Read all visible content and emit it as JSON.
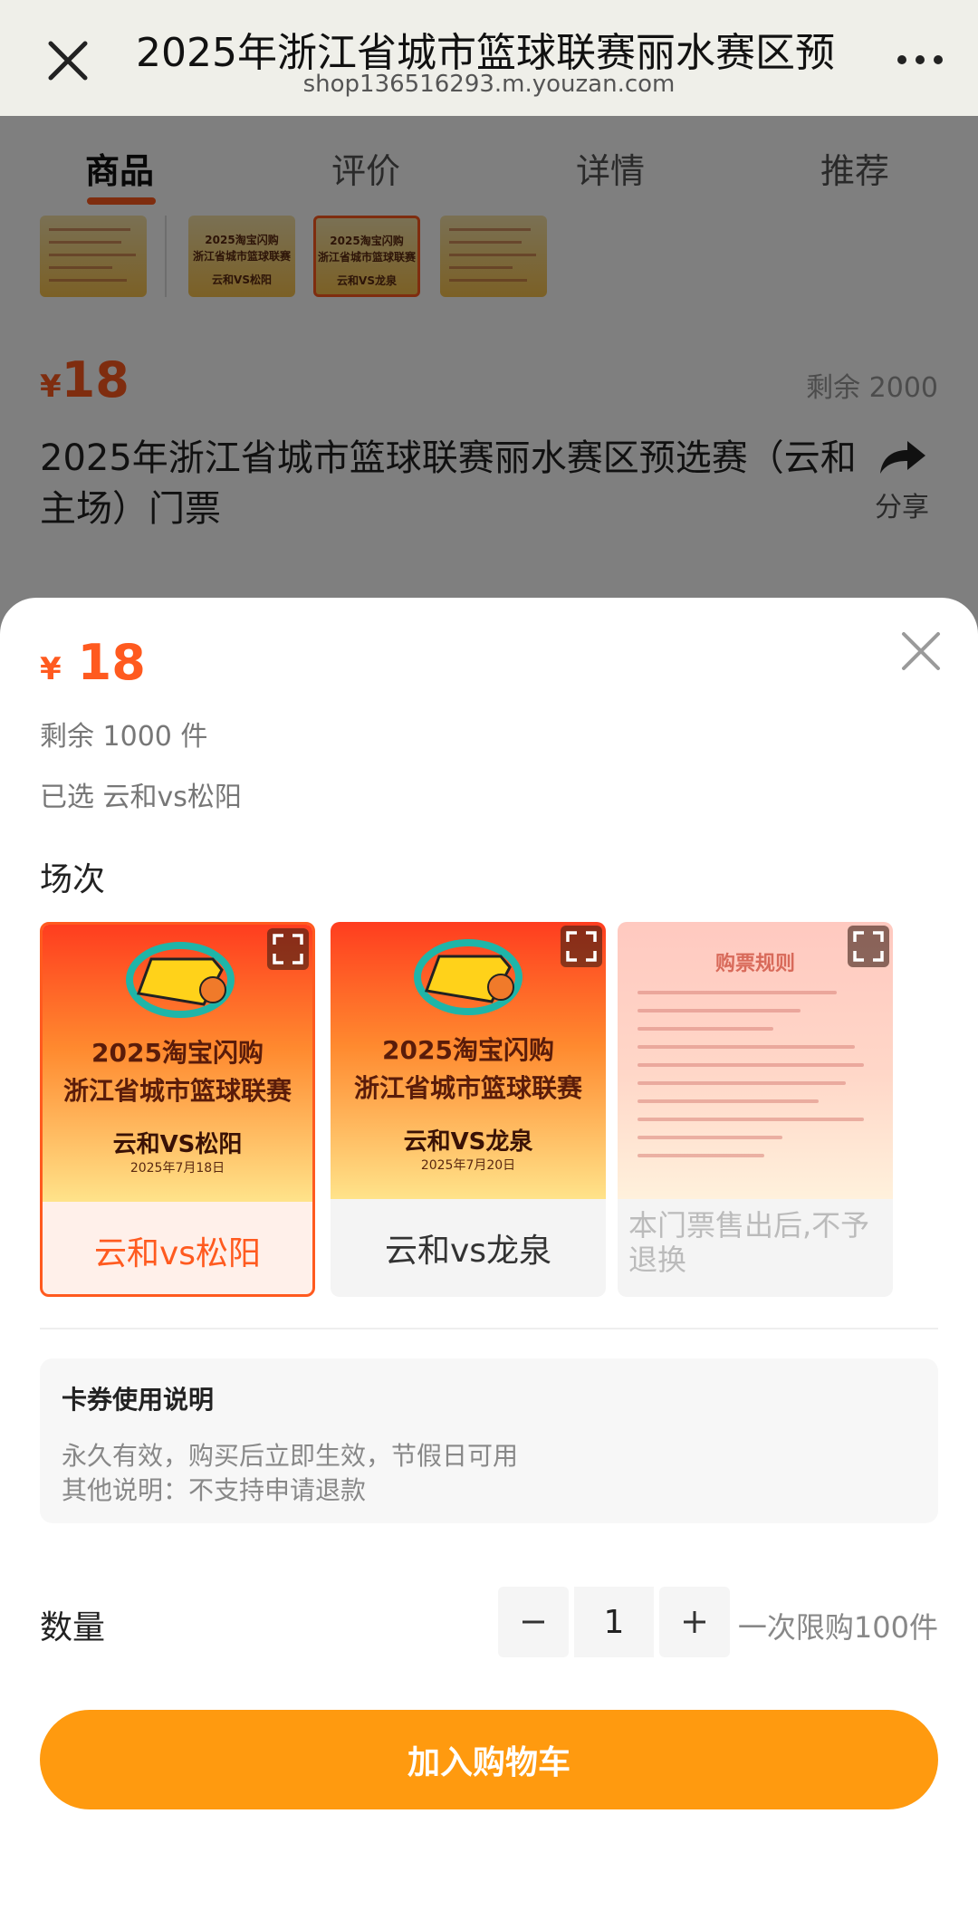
{
  "browser": {
    "title": "2025年浙江省城市篮球联赛丽水赛区预",
    "url": "shop136516293.m.youzan.com"
  },
  "tabs": [
    {
      "label": "商品"
    },
    {
      "label": "评价"
    },
    {
      "label": "详情"
    },
    {
      "label": "推荐"
    }
  ],
  "product": {
    "price_symbol": "¥",
    "price": "18",
    "stock": "剩余 2000",
    "name": "2025年浙江省城市篮球联赛丽水赛区预选赛（云和主场）门票",
    "share_label": "分享",
    "thumbs": [
      {
        "line1": "",
        "line2": ""
      },
      {
        "line1": "2025淘宝闪购",
        "line2": "浙江省城市篮球联赛",
        "match": "云和VS松阳"
      },
      {
        "line1": "2025淘宝闪购",
        "line2": "浙江省城市篮球联赛",
        "match": "云和VS龙泉"
      },
      {
        "line1": "",
        "line2": ""
      }
    ]
  },
  "sheet": {
    "price_symbol": "¥",
    "price": "18",
    "stock": "剩余  1000  件",
    "selected": "已选  云和vs松阳",
    "section_title": "场次",
    "options": [
      {
        "label": "云和vs松阳",
        "poster_line1": "2025淘宝闪购",
        "poster_line2": "浙江省城市篮球联赛",
        "poster_line3": "云和VS松阳",
        "poster_date": "2025年7月18日",
        "selected": true
      },
      {
        "label": "云和vs龙泉",
        "poster_line1": "2025淘宝闪购",
        "poster_line2": "浙江省城市篮球联赛",
        "poster_line3": "云和VS龙泉",
        "poster_date": "2025年7月20日",
        "selected": false
      },
      {
        "label": "本门票售出后,不予退换",
        "poster_title": "购票规则",
        "selected": false,
        "disabled": true
      }
    ],
    "card": {
      "title": "卡券使用说明",
      "line1": "永久有效，购买后立即生效，节假日可用",
      "line2": "其他说明：不支持申请退款"
    },
    "quantity": {
      "label": "数量",
      "value": "1",
      "limit": "一次限购100件"
    },
    "add_to_cart": "加入购物车"
  },
  "colors": {
    "accent": "#ff5a1f",
    "cart_button": "#ff9a0f",
    "overlay": "rgba(0,0,0,0.5)"
  },
  "icons": [
    "close-icon",
    "more-icon",
    "share-icon",
    "expand-icon",
    "minus-icon",
    "plus-icon",
    "basketball-logo-icon"
  ]
}
